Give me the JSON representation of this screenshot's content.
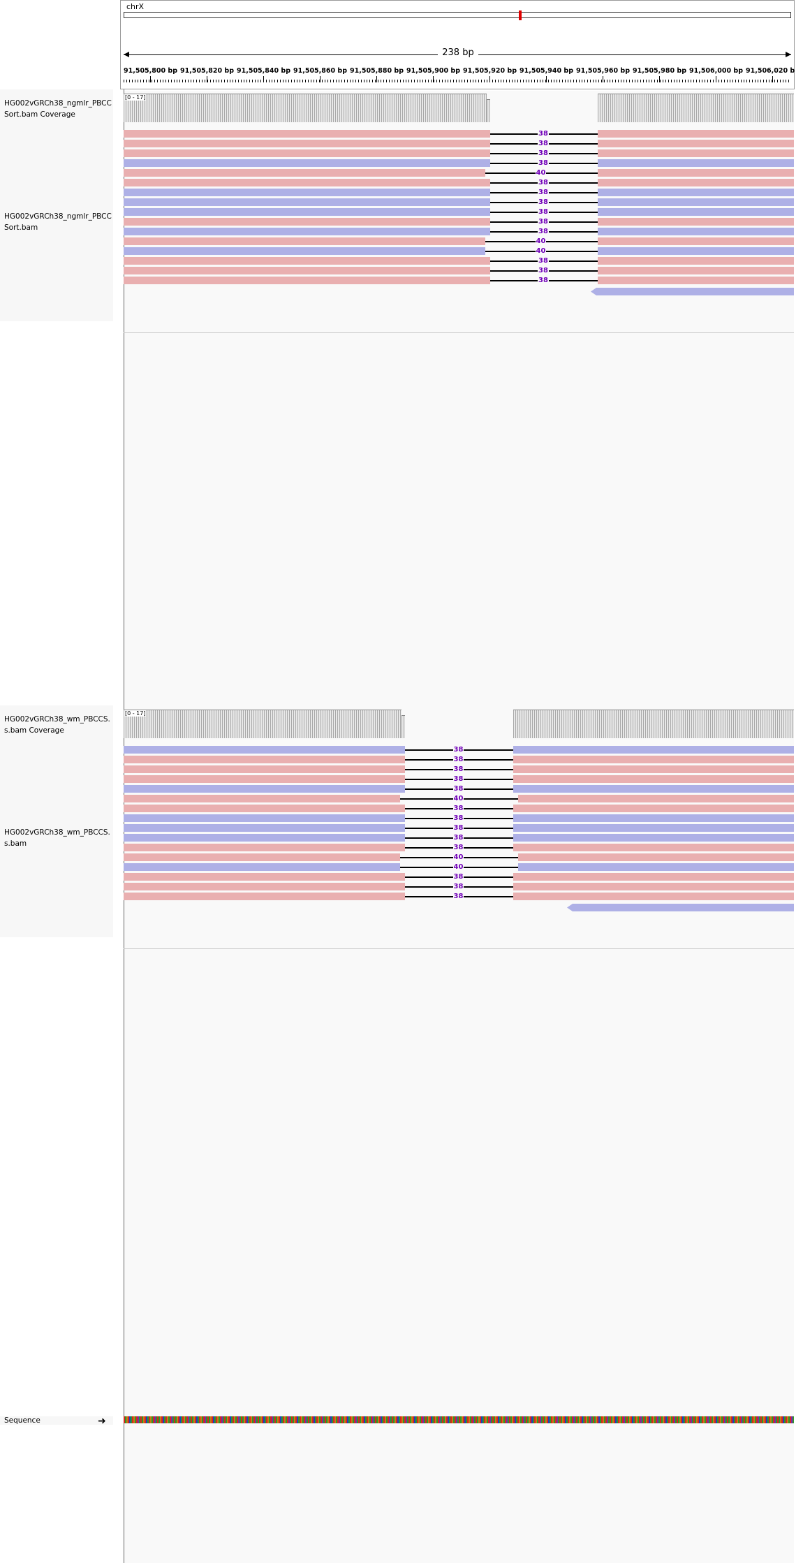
{
  "ruler": {
    "chromosome": "chrX",
    "span_label": "238 bp",
    "ticks": [
      "91,505,800 bp",
      "91,505,820 bp",
      "91,505,840 bp",
      "91,505,860 bp",
      "91,505,880 bp",
      "91,505,900 bp",
      "91,505,920 bp",
      "91,505,940 bp",
      "91,505,960 bp",
      "91,505,980 bp",
      "91,506,000 bp",
      "91,506,020 b"
    ]
  },
  "tracks": [
    {
      "coverage_name": "HG002vGRCh38_ngmlr_PBCCSort.bam Coverage",
      "coverage_range": "[0 - 17]",
      "alignment_name": "HG002vGRCh38_ngmlr_PBCCSort.bam",
      "deletions": [
        "38",
        "38",
        "38",
        "38",
        "40",
        "38",
        "38",
        "38",
        "38",
        "38",
        "38",
        "40",
        "40",
        "38",
        "38",
        "38"
      ],
      "read_strands": [
        "red",
        "red",
        "red",
        "blue",
        "red",
        "red",
        "blue",
        "blue",
        "blue",
        "red",
        "blue",
        "red",
        "blue",
        "red",
        "red",
        "red"
      ]
    },
    {
      "coverage_name": "HG002vGRCh38_wm_PBCCS.s.bam Coverage",
      "coverage_range": "[0 - 17]",
      "alignment_name": "HG002vGRCh38_wm_PBCCS.s.bam",
      "deletions": [
        "38",
        "38",
        "38",
        "38",
        "38",
        "40",
        "38",
        "38",
        "38",
        "38",
        "38",
        "40",
        "40",
        "38",
        "38",
        "38"
      ],
      "read_strands": [
        "blue",
        "red",
        "red",
        "red",
        "blue",
        "red",
        "red",
        "blue",
        "blue",
        "blue",
        "red",
        "red",
        "blue",
        "red",
        "red",
        "red"
      ]
    }
  ],
  "sequence": {
    "label": "Sequence",
    "strand_icon": "right-arrow-icon"
  },
  "colors": {
    "forward_read": "#e9afb0",
    "reverse_read": "#aeb0e6",
    "deletion_label": "#7000b8",
    "ideogram_marker": "#e00000"
  }
}
